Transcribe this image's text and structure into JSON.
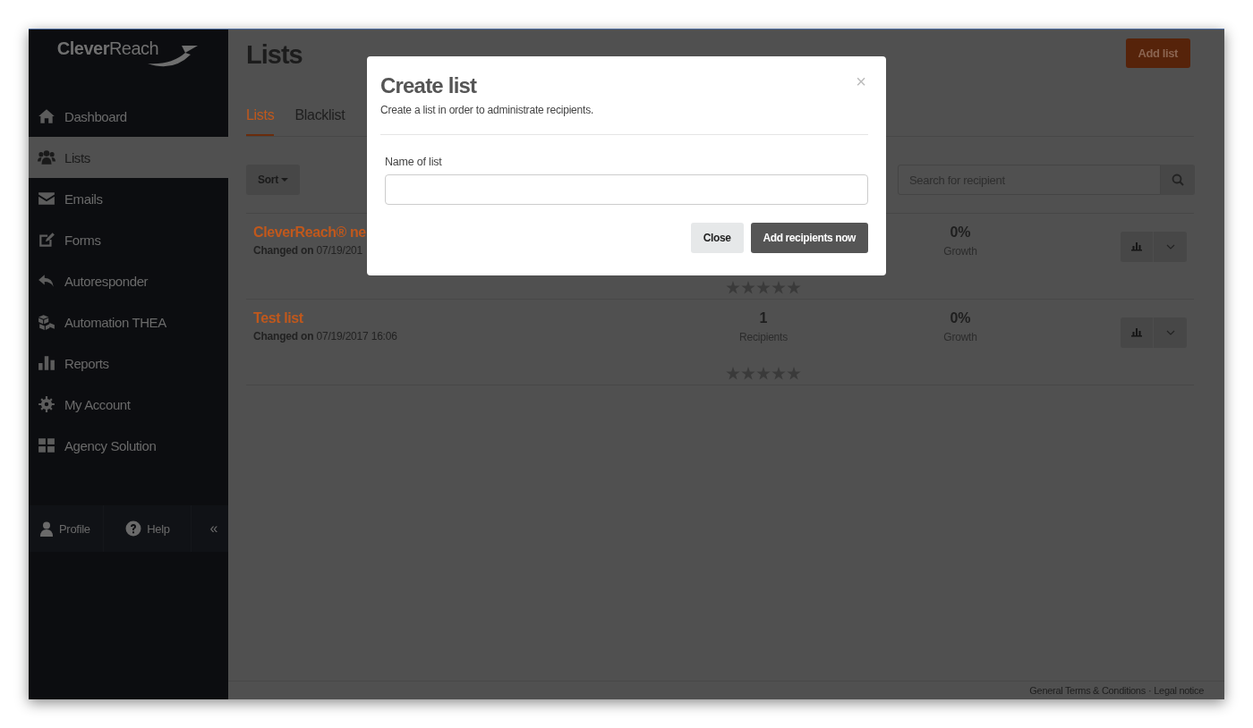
{
  "sidebar": {
    "logo": "**Clever**Reach",
    "items": [
      {
        "label": "Dashboard",
        "selected": false
      },
      {
        "label": "Lists",
        "selected": true
      },
      {
        "label": "Emails",
        "selected": false
      },
      {
        "label": "Forms",
        "selected": false
      },
      {
        "label": "Autoresponder",
        "selected": false
      },
      {
        "label": "Automation THEA",
        "selected": false
      },
      {
        "label": "Reports",
        "selected": false
      },
      {
        "label": "My Account",
        "selected": false
      },
      {
        "label": "Agency Solution",
        "selected": false
      }
    ],
    "footer": {
      "profile": "Profile",
      "help": "Help",
      "collapse": "«"
    }
  },
  "page": {
    "title": "Lists",
    "add_button": "Add list",
    "tabs": [
      {
        "label": "Lists",
        "selected": true
      },
      {
        "label": "Blacklist",
        "selected": false
      }
    ],
    "sort_button": "Sort",
    "search": {
      "placeholder": "Search for recipient"
    },
    "rows": [
      {
        "name": "CleverReach® ne",
        "changed_label": "Changed on",
        "changed_date": "07/19/201",
        "growth": "0%",
        "growth_label": "Growth",
        "stars": 0
      },
      {
        "name": "Test list",
        "changed_label": "Changed on",
        "changed_date": "07/19/2017 16:06",
        "recipients": "1",
        "recipients_label": "Recipients",
        "growth": "0%",
        "growth_label": "Growth",
        "stars": 0
      }
    ]
  },
  "footer": {
    "links": [
      "General Terms & Conditions",
      "Legal notice"
    ],
    "separator": "·"
  },
  "modal": {
    "title": "Create list",
    "subtitle": "Create a list in order to administrate recipients.",
    "close": "×",
    "field_label": "Name of list",
    "buttons": [
      {
        "label": "Close",
        "kind": "secondary"
      },
      {
        "label": "Add recipients now",
        "kind": "primary"
      }
    ]
  }
}
